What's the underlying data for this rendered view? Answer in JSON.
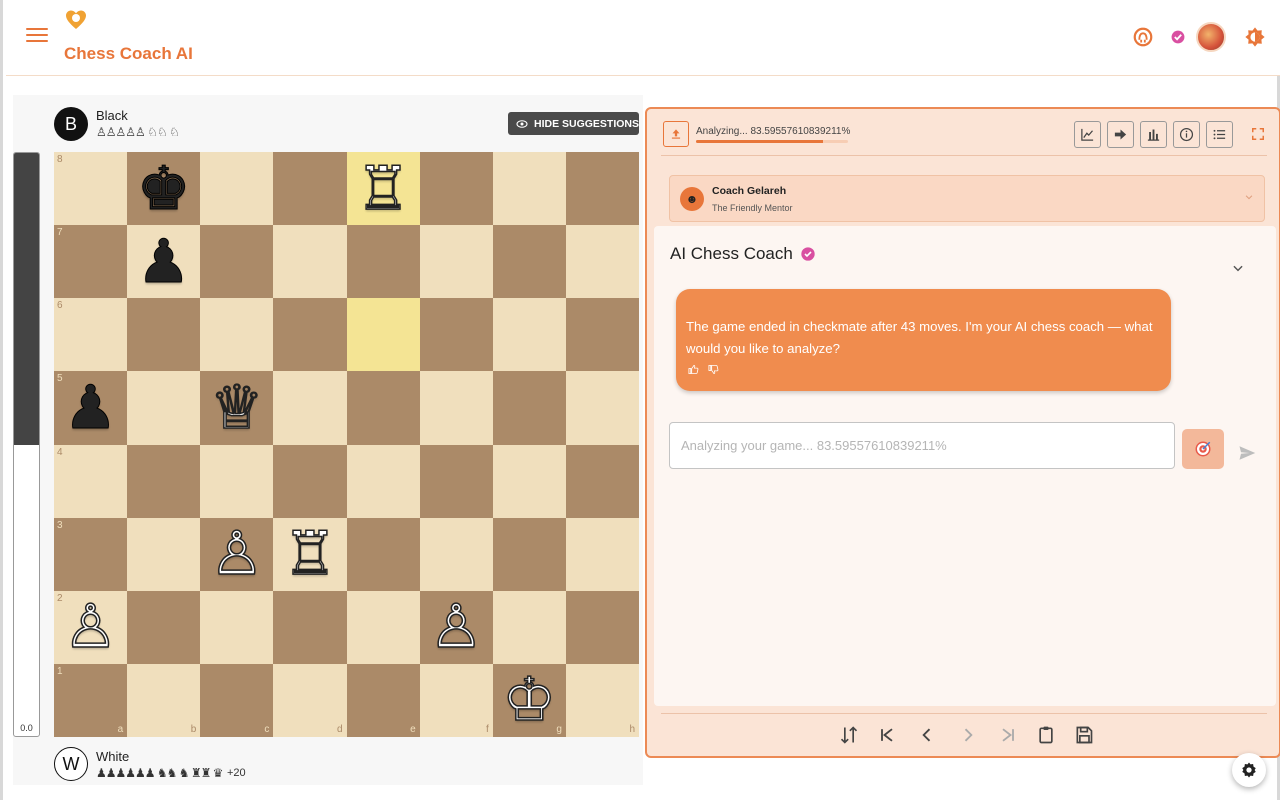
{
  "app": {
    "title": "Chess Coach AI"
  },
  "header": {
    "icons": [
      "menu-icon",
      "heart-logo-icon",
      "github-icon",
      "verified-badge-icon",
      "avatar",
      "theme-toggle-icon"
    ],
    "accent": "#e8763a"
  },
  "board": {
    "hide_suggestions_label": "HIDE SUGGESTIONS",
    "files": [
      "a",
      "b",
      "c",
      "d",
      "e",
      "f",
      "g",
      "h"
    ],
    "ranks": [
      "8",
      "7",
      "6",
      "5",
      "4",
      "3",
      "2",
      "1"
    ],
    "highlighted": [
      "e8",
      "e6"
    ],
    "pieces": {
      "b8": {
        "symbol": "♚",
        "color": "b"
      },
      "e8": {
        "symbol": "♖",
        "color": "w"
      },
      "b7": {
        "symbol": "♟",
        "color": "b"
      },
      "a5": {
        "symbol": "♟",
        "color": "b"
      },
      "c5": {
        "symbol": "♕",
        "color": "w"
      },
      "c3": {
        "symbol": "♙",
        "color": "w"
      },
      "d3": {
        "symbol": "♖",
        "color": "w"
      },
      "a2": {
        "symbol": "♙",
        "color": "w"
      },
      "f2": {
        "symbol": "♙",
        "color": "w"
      },
      "g1": {
        "symbol": "♔",
        "color": "w"
      }
    },
    "light_color": "#f0dfbd",
    "dark_color": "#ab8a68"
  },
  "eval": {
    "value": "0.0",
    "black_fraction": 0.5
  },
  "players": {
    "black": {
      "badge": "B",
      "name": "Black",
      "captured": "♙♙♙♙♙ ♘♘ ♘"
    },
    "white": {
      "badge": "W",
      "name": "White",
      "captured": "♟♟♟♟♟♟ ♞♞ ♞ ♜♜ ♛",
      "advantage": "+20"
    }
  },
  "analysis": {
    "progress_text": "Analyzing... 83.59557610839211%",
    "progress": 0.8359,
    "toolbar_icons": [
      "line-chart-icon",
      "arrow-icon",
      "bar-chart-icon",
      "info-icon",
      "list-icon"
    ]
  },
  "coach": {
    "name": "Coach Gelareh",
    "role": "The Friendly Mentor"
  },
  "chat": {
    "title": "AI Chess Coach",
    "message": "The game ended in checkmate after 43 moves. I'm your AI chess coach — what would you like to analyze?",
    "input_placeholder": "Analyzing your game... 83.59557610839211%"
  },
  "navigation": {
    "icons": [
      "flip-board-icon",
      "first-move-icon",
      "previous-move-icon",
      "next-move-icon",
      "last-move-icon",
      "clipboard-icon",
      "save-icon"
    ]
  }
}
